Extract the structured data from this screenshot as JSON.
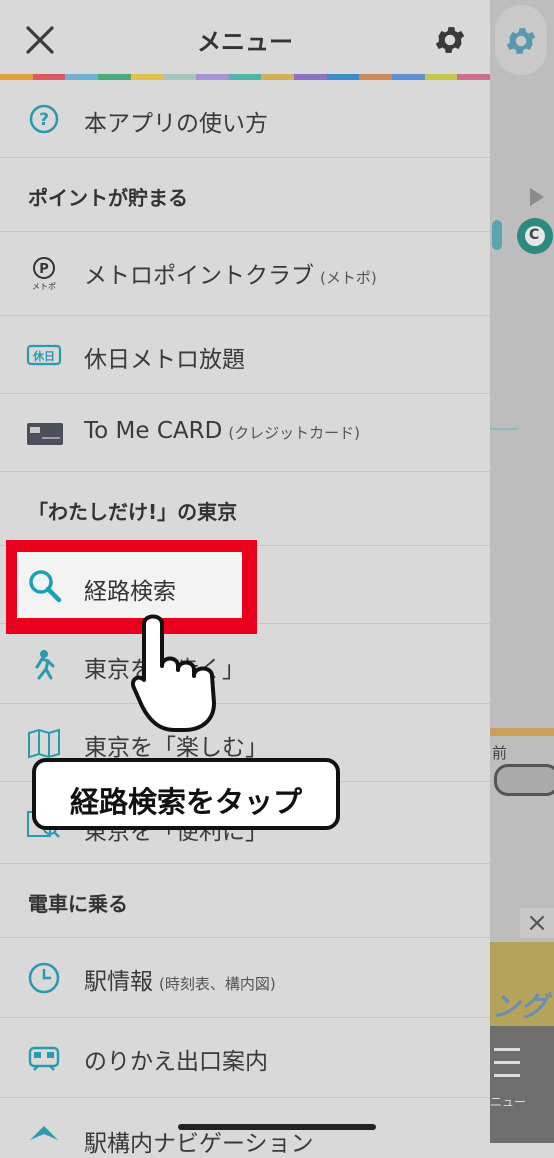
{
  "header": {
    "title": "メニュー"
  },
  "rainbow_colors": [
    "#e0a03a",
    "#d95a62",
    "#6fb2d6",
    "#4aaa7c",
    "#e3c14f",
    "#a5c5bf",
    "#a695d4",
    "#4fb6a8",
    "#d2b05a",
    "#8a73c0",
    "#3a8ec4",
    "#d08858",
    "#5f8fd1",
    "#c4c84a",
    "#cc6f8f"
  ],
  "menu": {
    "how_to_use": "本アプリの使い方",
    "section_points": "ポイントが貯まる",
    "metro_point_club": "メトロポイントクラブ",
    "metro_point_club_sub": "(メトポ)",
    "metro_point_icon_caption": "メトポ",
    "holiday_pass": "休日メトロ放題",
    "holiday_pass_icon_text": "休日",
    "to_me_card": "To Me CARD",
    "to_me_card_sub": "(クレジットカード)",
    "section_tokyo": "「わたしだけ!」の東京",
    "route_search": "経路検索",
    "tokyo_walk": "東京を「歩く」",
    "tokyo_enjoy": "東京を「楽しむ」",
    "tokyo_convenient": "東京を「便利に」",
    "section_train": "電車に乗る",
    "station_info": "駅情報",
    "station_info_sub": "(時刻表、構内図)",
    "transfer_exit": "のりかえ出口案内",
    "station_navigation": "駅構内ナビゲーション"
  },
  "callout": {
    "text": "経路検索をタップ"
  },
  "background": {
    "mae_label": "前",
    "nav_label": "ニュー",
    "c_letter": "C"
  }
}
